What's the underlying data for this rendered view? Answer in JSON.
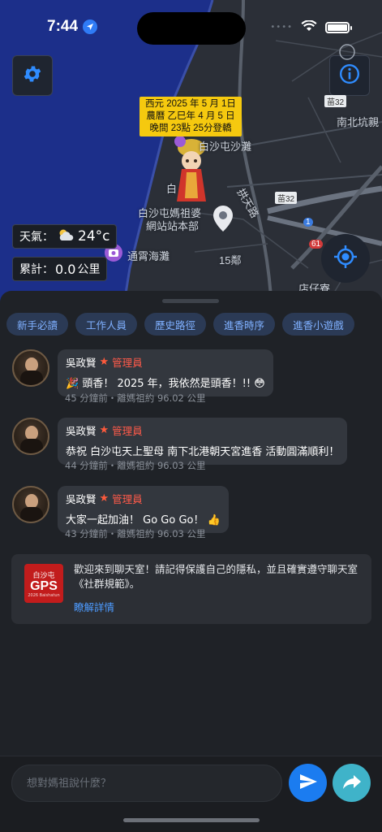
{
  "status_bar": {
    "time": "7:44",
    "cellular_dots": "••••"
  },
  "map": {
    "date_lines": [
      "西元 2025 年 5 月 1日",
      "農曆 乙巳年 4 月 5 日",
      "晚間 23點 25分登轎"
    ],
    "labels": {
      "beach_top": "白沙屯沙灘",
      "temple_name": "白沙屯媽祖婆",
      "temple_sub": "網站站本部",
      "tongxiao": "通霄海灘",
      "nanbei": "南北坑親",
      "gongtian": "拱天路",
      "village15": "15鄰",
      "dianzi": "店仔寮",
      "bai": "白"
    },
    "road_badges": {
      "r1": "苗32",
      "r2": "苗32",
      "r3": "1",
      "r4": "61"
    },
    "weather": {
      "label": "天氣：",
      "temp": "24°c"
    },
    "counter": {
      "label": "累計：",
      "value": "0.0",
      "unit": "公里"
    }
  },
  "tabs": [
    "新手必讀",
    "工作人員",
    "歷史路徑",
    "進香時序",
    "進香小遊戲"
  ],
  "messages": [
    {
      "name": "吳政賢",
      "role": "管理員",
      "text": "🎉 頭香！ 2025 年，我依然是頭香！!! 😳",
      "meta": "45 分鐘前・離媽祖約 96.02 公里"
    },
    {
      "name": "吳政賢",
      "role": "管理員",
      "text": "恭祝 白沙屯天上聖母 南下北港朝天宮進香 活動圓滿順利！",
      "meta": "44 分鐘前・離媽祖約 96.03 公里"
    },
    {
      "name": "吳政賢",
      "role": "管理員",
      "text": "大家一起加油！ Go Go Go！ 👍",
      "meta": "43 分鐘前・離媽祖約 96.03 公里"
    }
  ],
  "notice": {
    "logo_top": "白沙屯",
    "logo_mid": "GPS",
    "logo_bot": "2026 Baishatun",
    "text": "歡迎來到聊天室！請記得保護自己的隱私，並且確實遵守聊天室《社群規範》。",
    "link": "瞭解詳情"
  },
  "input": {
    "placeholder": "想對媽祖說什麼？"
  },
  "colors": {
    "accent": "#1b7cf0",
    "share": "#3fb3c9",
    "date_box": "#f5c90f",
    "admin_red": "#ff5a4a"
  }
}
